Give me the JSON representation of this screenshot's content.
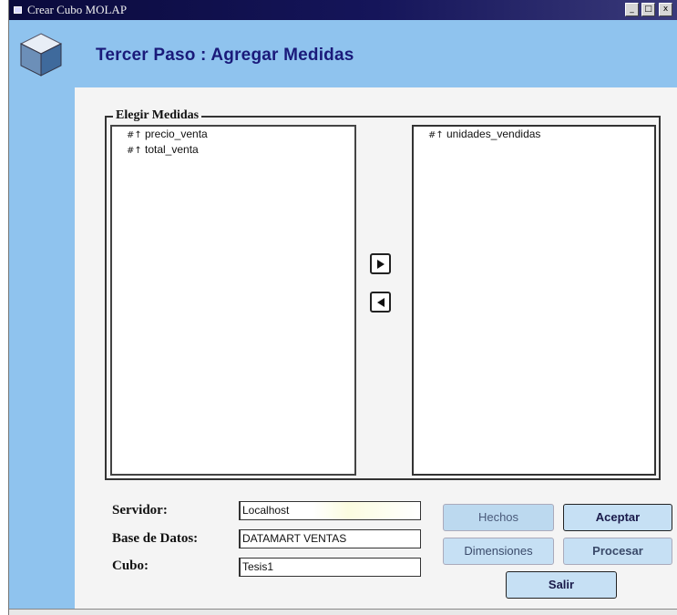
{
  "window": {
    "title": "Crear Cubo MOLAP",
    "controls": {
      "minimize": "_",
      "maximize": "□",
      "close": "x"
    }
  },
  "header": {
    "title": "Tercer Paso : Agregar Medidas",
    "icon": "cube-icon"
  },
  "measures_group": {
    "legend": "Elegir Medidas",
    "available": [
      {
        "label": "precio_venta",
        "icon": "measure-icon"
      },
      {
        "label": "total_venta",
        "icon": "measure-icon"
      }
    ],
    "selected": [
      {
        "label": "unidades_vendidas",
        "icon": "measure-icon"
      }
    ],
    "move_right_icon": "arrow-right-icon",
    "move_left_icon": "arrow-left-icon"
  },
  "form": {
    "servidor_label": "Servidor:",
    "servidor_value": "Localhost",
    "base_datos_label": "Base de Datos:",
    "base_datos_value": "DATAMART VENTAS",
    "cubo_label": "Cubo:",
    "cubo_value": "Tesis1"
  },
  "buttons": {
    "hechos": "Hechos",
    "aceptar": "Aceptar",
    "dimensiones": "Dimensiones",
    "procesar": "Procesar",
    "salir": "Salir"
  },
  "colors": {
    "header_bg": "#8fc3ee",
    "title_text": "#1a1a7a",
    "titlebar_bg": "#0a0a3c"
  }
}
